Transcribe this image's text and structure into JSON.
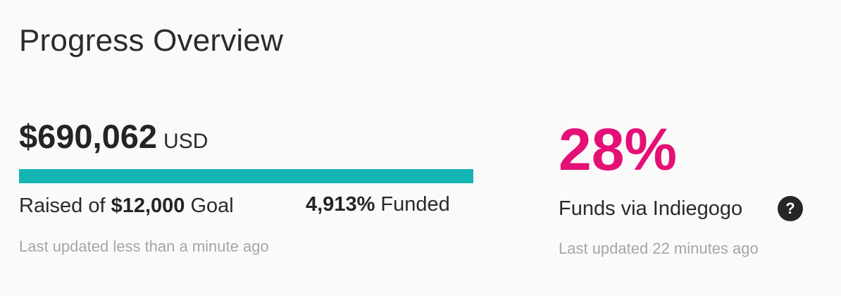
{
  "title": "Progress Overview",
  "campaign": {
    "amount": "$690,062",
    "currency": "USD",
    "raised_prefix": "Raised of ",
    "goal": "$12,000",
    "raised_suffix": " Goal",
    "funded_percent": "4,913%",
    "funded_label": " Funded",
    "updated": "Last updated less than a minute ago",
    "progress_fraction": 1.0
  },
  "indiegogo": {
    "percent": "28%",
    "label": "Funds via Indiegogo",
    "help_icon": "question-circle-icon",
    "help_glyph": "?",
    "updated": "Last updated 22 minutes ago"
  },
  "colors": {
    "accent_teal": "#14b4b4",
    "accent_pink": "#e51075",
    "muted_text": "#a6a6a6"
  }
}
